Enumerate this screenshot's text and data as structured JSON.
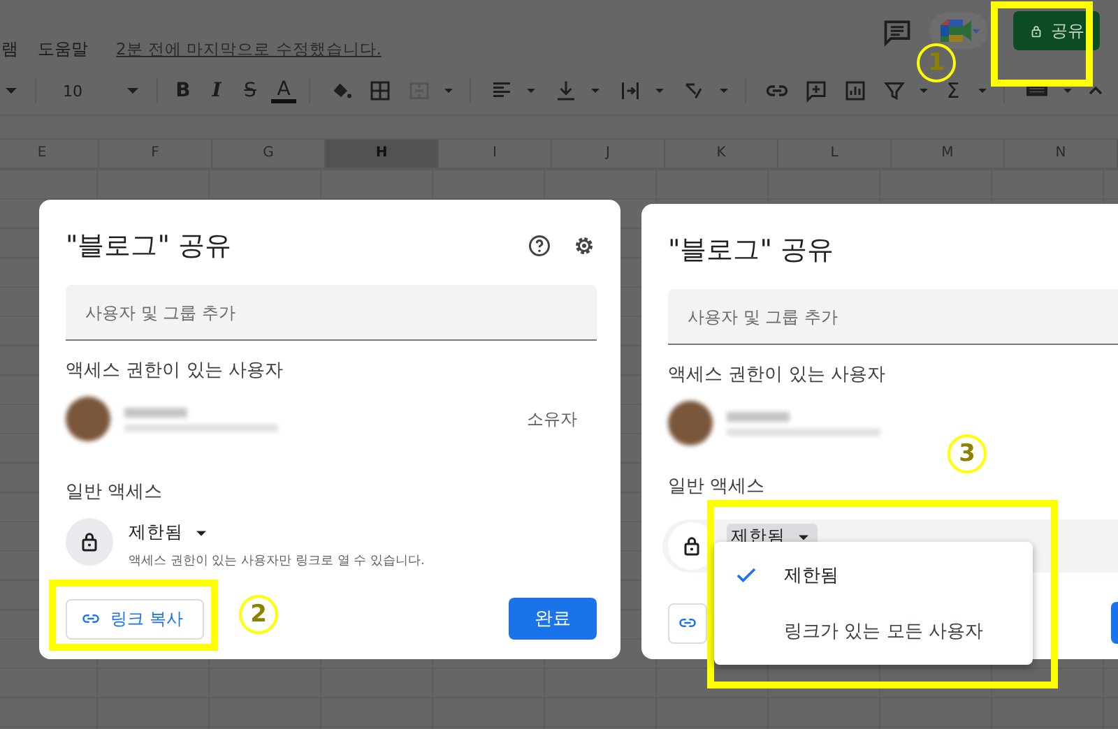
{
  "top_bar": {
    "menus": [
      "램",
      "도움말"
    ],
    "last_edit": "2분 전에 마지막으로 수정했습니다.",
    "share_button": "공유"
  },
  "toolbar": {
    "font_size": "10",
    "format_buttons": [
      "B",
      "I",
      "S",
      "A"
    ],
    "sum": "Σ"
  },
  "columns": [
    {
      "label": "E",
      "selected": false
    },
    {
      "label": "F",
      "selected": false
    },
    {
      "label": "G",
      "selected": false
    },
    {
      "label": "H",
      "selected": true
    },
    {
      "label": "I",
      "selected": false
    },
    {
      "label": "J",
      "selected": false
    },
    {
      "label": "K",
      "selected": false
    },
    {
      "label": "L",
      "selected": false
    },
    {
      "label": "M",
      "selected": false
    },
    {
      "label": "N",
      "selected": false
    }
  ],
  "dialogs": [
    {
      "kind": "full",
      "title": "\"블로그\" 공유",
      "placeholder": "사용자 및 그룹 추가",
      "access_heading": "액세스 권한이 있는 사용자",
      "owner_label": "소유자",
      "general_heading": "일반 액세스",
      "access_value": "제한됨",
      "access_description": "액세스 권한이 있는 사용자만 링크로 열 수 있습니다.",
      "copy_link": "링크 복사",
      "done": "완료"
    },
    {
      "kind": "clipped",
      "title": "\"블로그\" 공유",
      "placeholder": "사용자 및 그룹 추가",
      "access_heading": "액세스 권한이 있는 사용자",
      "general_heading": "일반 액세스",
      "access_value": "제한됨",
      "menu": [
        {
          "label": "제한됨",
          "selected": true
        },
        {
          "label": "링크가 있는 모든 사용자",
          "selected": false
        }
      ]
    }
  ],
  "annotations": [
    {
      "number": "1"
    },
    {
      "number": "2"
    },
    {
      "number": "3"
    }
  ]
}
